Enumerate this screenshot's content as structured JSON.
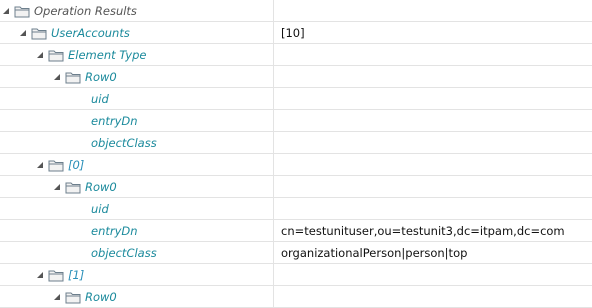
{
  "tree": {
    "rows": [
      {
        "label": "Operation Results",
        "value": ""
      },
      {
        "label": "UserAccounts",
        "value": "[10]"
      },
      {
        "label": "Element Type",
        "value": ""
      },
      {
        "label": "Row0",
        "value": ""
      },
      {
        "label": "uid",
        "value": ""
      },
      {
        "label": "entryDn",
        "value": ""
      },
      {
        "label": "objectClass",
        "value": ""
      },
      {
        "label": "[0]",
        "value": ""
      },
      {
        "label": "Row0",
        "value": ""
      },
      {
        "label": "uid",
        "value": ""
      },
      {
        "label": "entryDn",
        "value": "cn=testunituser,ou=testunit3,dc=itpam,dc=com"
      },
      {
        "label": "objectClass",
        "value": "organizationalPerson|person|top"
      },
      {
        "label": "[1]",
        "value": ""
      },
      {
        "label": "Row0",
        "value": ""
      }
    ]
  },
  "icons": {
    "expanded": "triangle-expanded-icon",
    "folder": "folder-icon"
  },
  "colors": {
    "label_teal": "#1b8a9c",
    "label_dark": "#555555",
    "label_blue": "#2a8fb8",
    "grid_line": "#e3e3e3"
  }
}
